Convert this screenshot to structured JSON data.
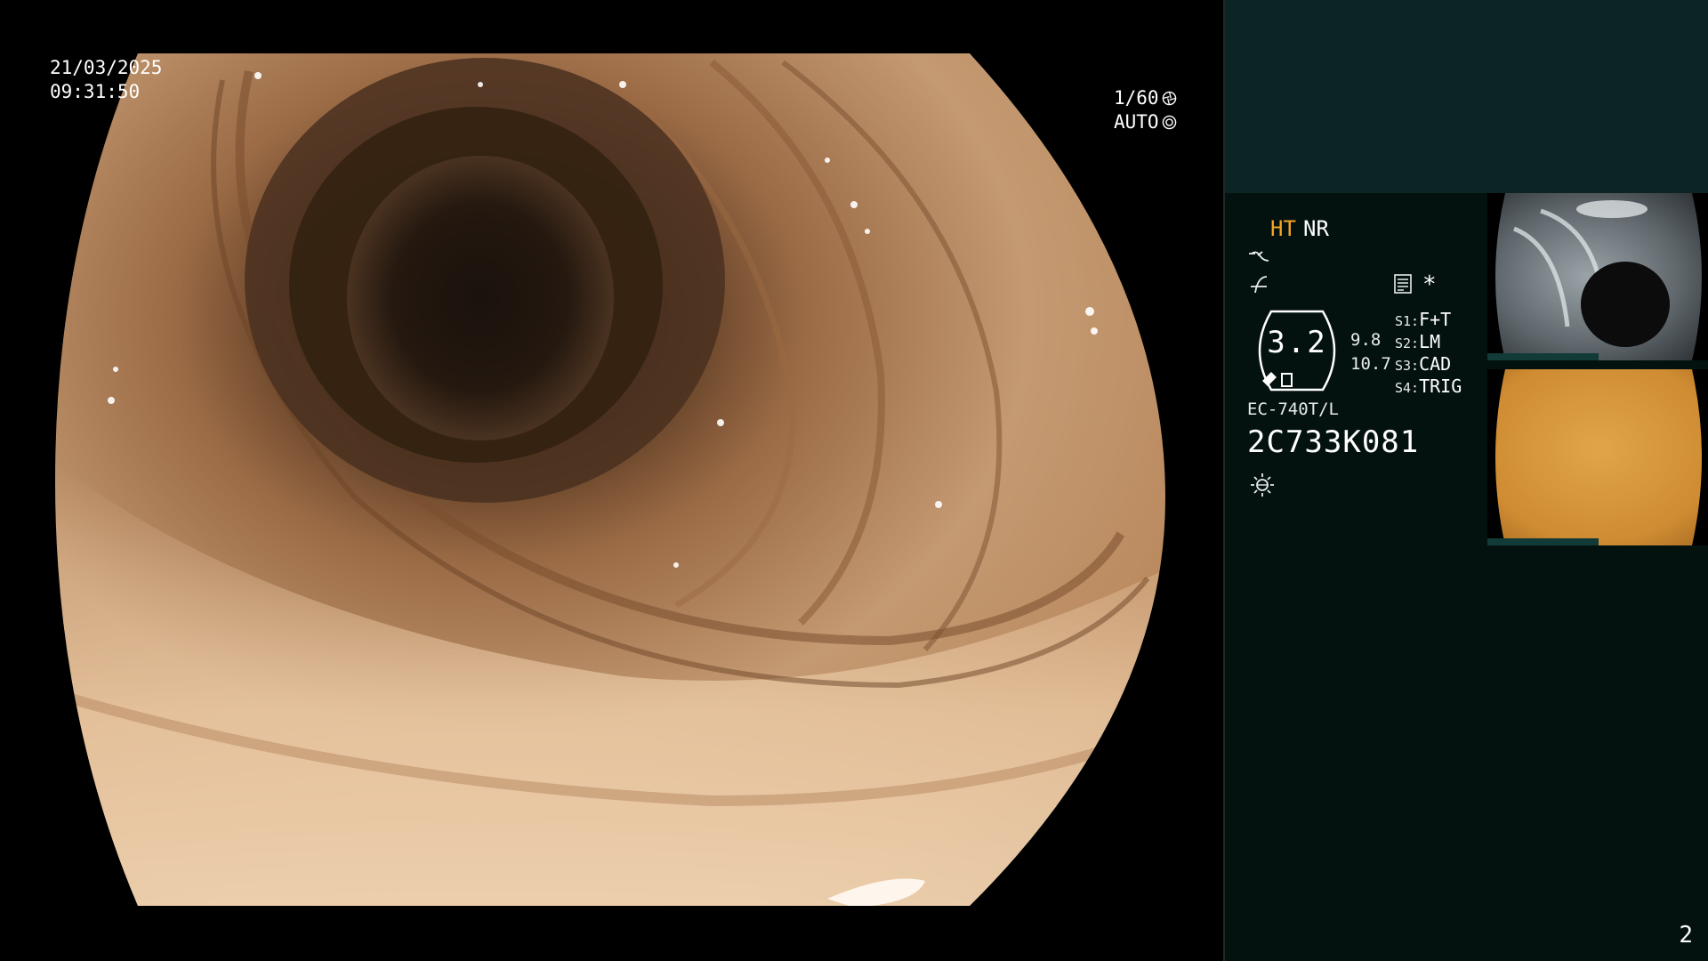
{
  "overlay": {
    "date": "21/03/2025",
    "time": "09:31:50",
    "shutter": "1/60",
    "iris_mode": "AUTO"
  },
  "panel": {
    "mode_ht": "HT",
    "mode_nr": "NR",
    "zoom_value": "3.2",
    "zoom_secondary_a": "9.8",
    "zoom_secondary_b": "10.7",
    "switches": [
      {
        "key": "S1:",
        "value": "F+T"
      },
      {
        "key": "S2:",
        "value": "LM"
      },
      {
        "key": "S3:",
        "value": "CAD"
      },
      {
        "key": "S4:",
        "value": "TRIG"
      }
    ],
    "scope_model": "EC-740T/L",
    "scope_serial": "2C733K081",
    "page_number": "2"
  },
  "colors": {
    "ht_accent": "#f5a623",
    "panel_bg": "#04120f",
    "panel_top_bg": "#0c2424"
  },
  "icons": [
    "shutter-icon",
    "auto-iris-icon",
    "enhance-curve-icon",
    "color-tone-icon",
    "record-doc-icon",
    "star-icon",
    "light-source-icon"
  ]
}
